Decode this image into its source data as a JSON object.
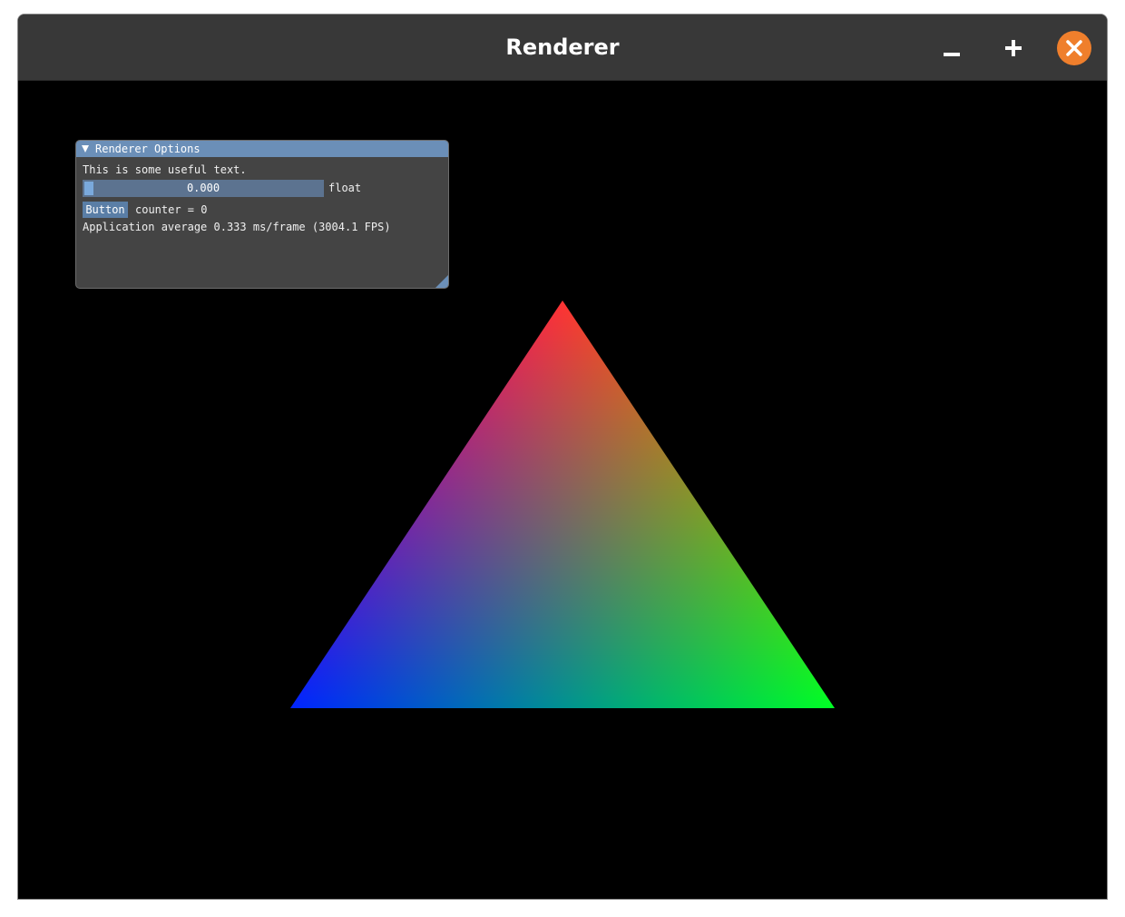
{
  "window": {
    "title": "Renderer",
    "close_color": "#ef7f2c",
    "titlebar_color": "#383838"
  },
  "viewport": {
    "background": "#000000",
    "triangle": {
      "vertex_colors": {
        "top": "#ff0000",
        "bottom_right": "#00ff00",
        "bottom_left": "#0000ff"
      }
    }
  },
  "panel": {
    "title": "Renderer Options",
    "text": "This is some useful text.",
    "slider": {
      "value": "0.000",
      "label": "float",
      "fraction": 0.0
    },
    "button_label": "Button",
    "counter_text": "counter = 0",
    "stats_text": "Application average 0.333 ms/frame (3004.1 FPS)",
    "accent_color": "#6b8fb8"
  },
  "icons": {
    "minimize": "minimize-icon",
    "maximize": "plus-icon",
    "close": "close-icon",
    "collapse": "triangle-down-icon",
    "resize": "resize-grip-icon"
  }
}
